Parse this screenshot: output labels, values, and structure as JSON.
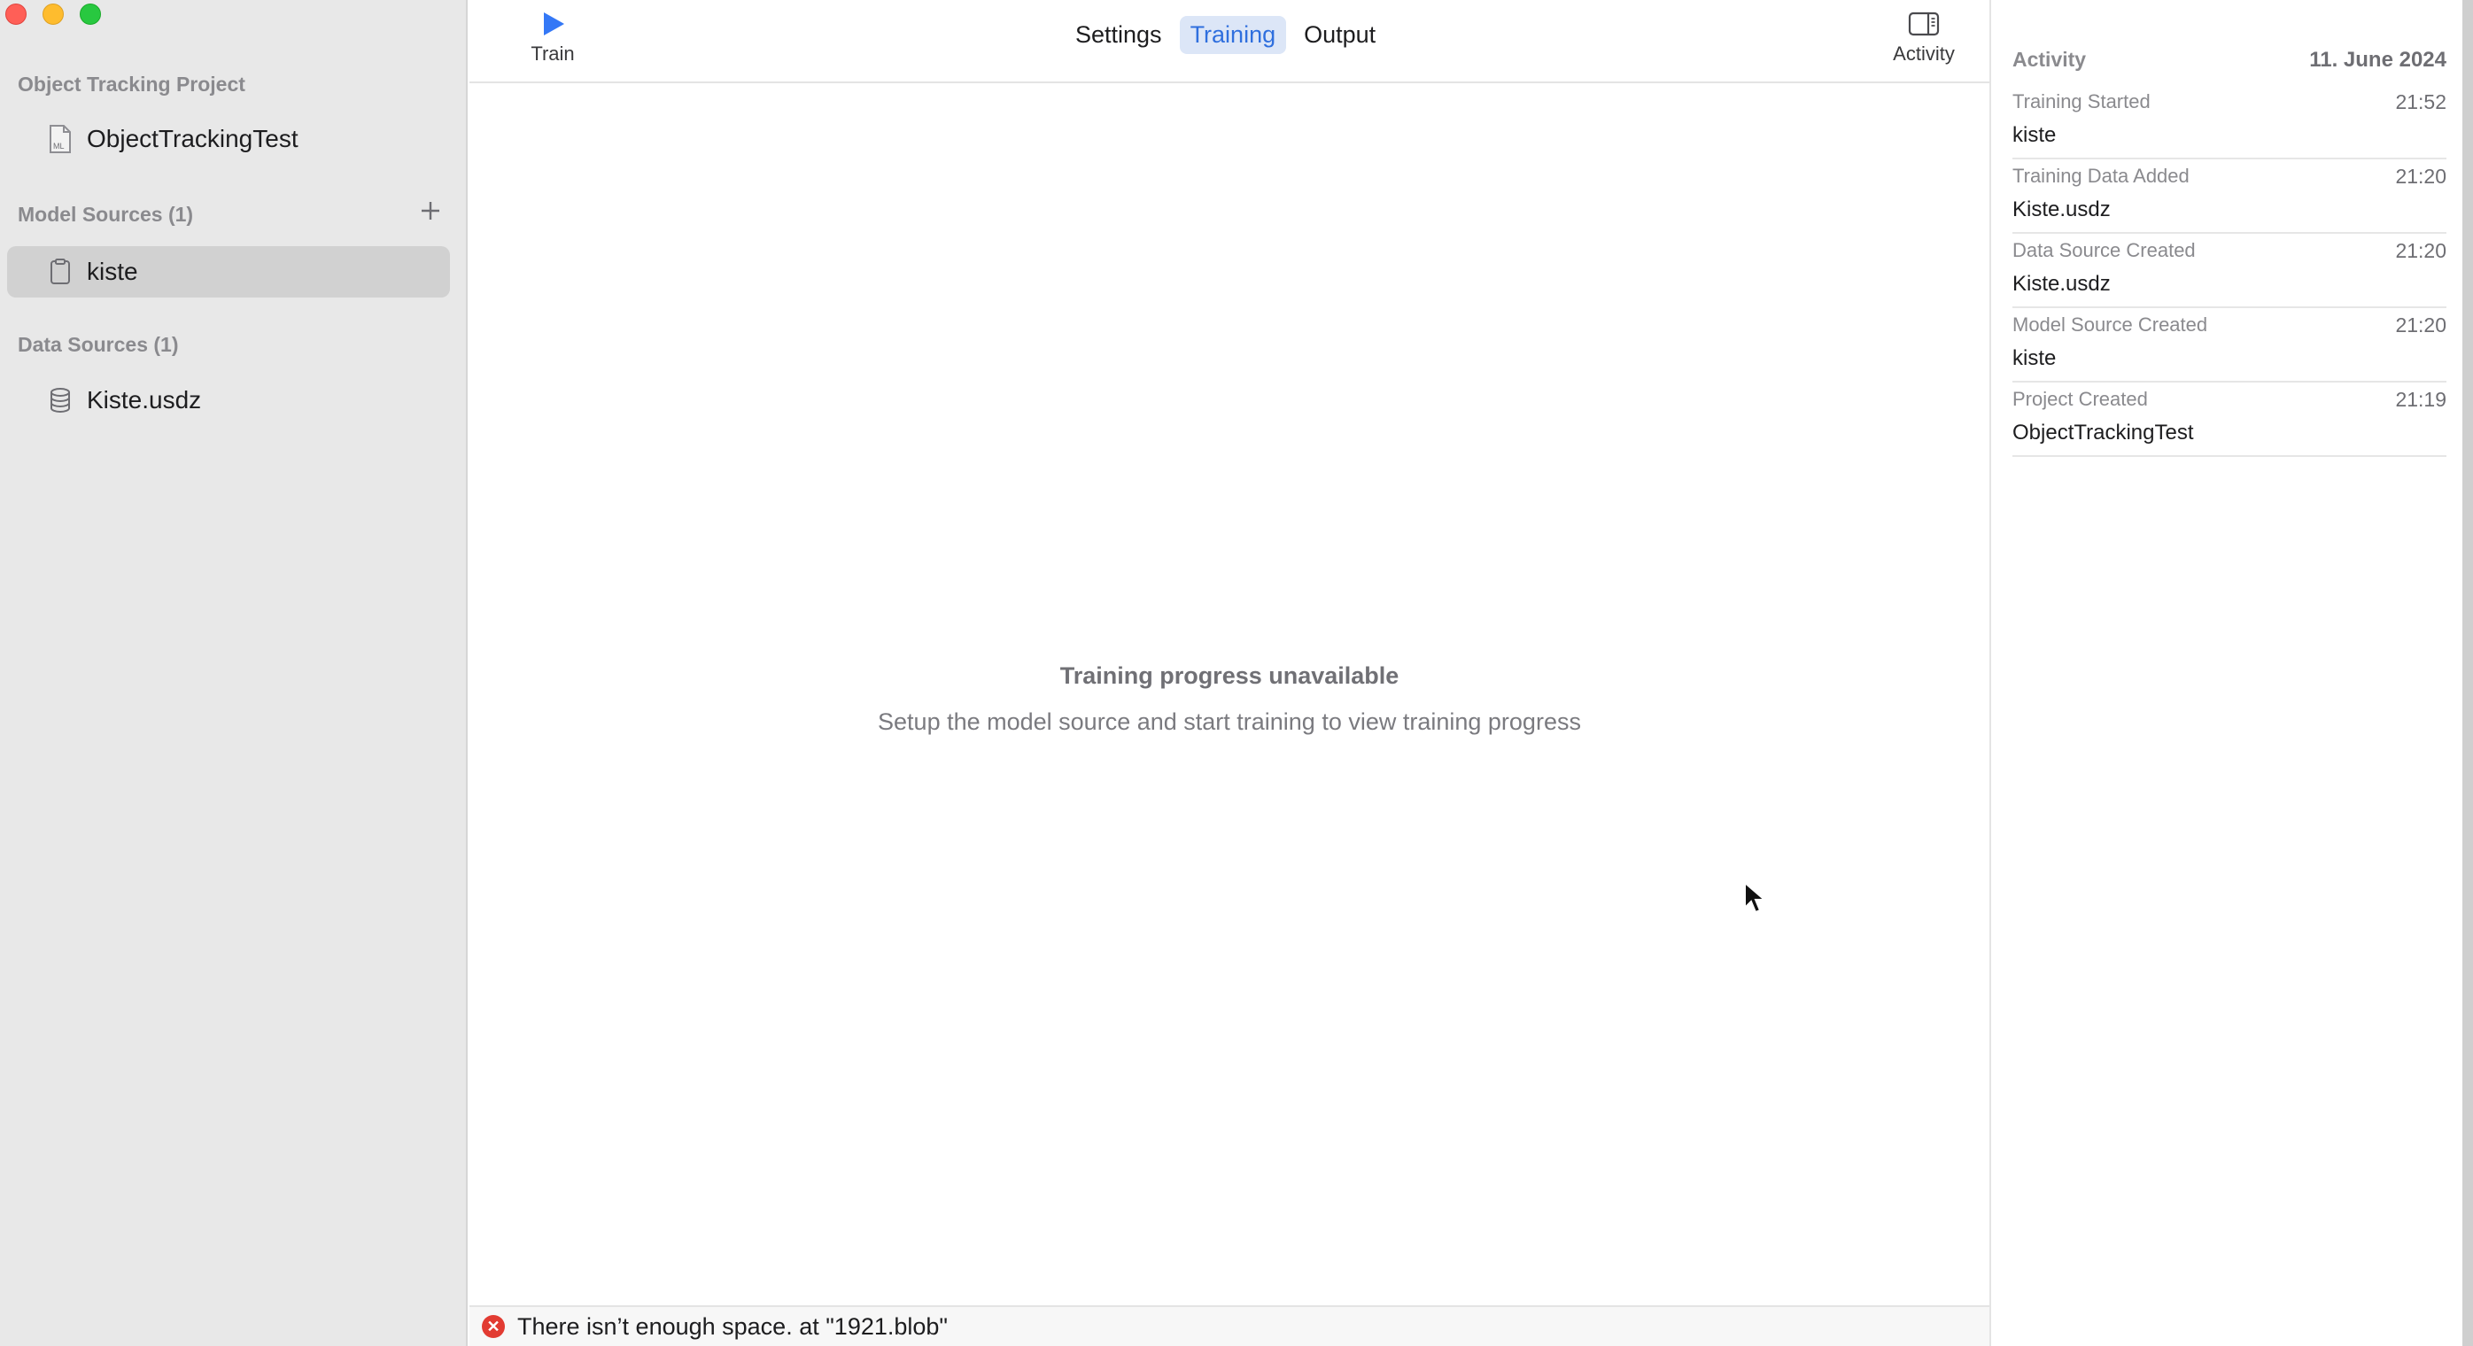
{
  "sidebar": {
    "project_header": "Object Tracking Project",
    "project_item": {
      "label": "ObjectTrackingTest",
      "icon": "ml-file-icon"
    },
    "model_sources_header": "Model Sources (1)",
    "model_sources": [
      {
        "label": "kiste",
        "icon": "document-icon",
        "selected": true
      }
    ],
    "data_sources_header": "Data Sources (1)",
    "data_sources": [
      {
        "label": "Kiste.usdz",
        "icon": "database-icon"
      }
    ]
  },
  "toolbar": {
    "train_label": "Train",
    "tabs": [
      {
        "label": "Settings",
        "active": false
      },
      {
        "label": "Training",
        "active": true
      },
      {
        "label": "Output",
        "active": false
      }
    ],
    "activity_label": "Activity"
  },
  "main": {
    "empty_title": "Training progress unavailable",
    "empty_subtitle": "Setup the model source and start training to view training progress"
  },
  "error": {
    "message": "There isn’t enough space. at \"1921.blob\""
  },
  "activity": {
    "title": "Activity",
    "date": "11. June 2024",
    "items": [
      {
        "event": "Training Started",
        "time": "21:52",
        "subject": "kiste"
      },
      {
        "event": "Training Data Added",
        "time": "21:20",
        "subject": "Kiste.usdz"
      },
      {
        "event": "Data Source Created",
        "time": "21:20",
        "subject": "Kiste.usdz"
      },
      {
        "event": "Model Source Created",
        "time": "21:20",
        "subject": "kiste"
      },
      {
        "event": "Project Created",
        "time": "21:19",
        "subject": "ObjectTrackingTest"
      }
    ]
  },
  "colors": {
    "accent": "#2f6fde",
    "tab_active_bg": "#dce6f7",
    "error": "#e23b32",
    "play": "#3478f6"
  }
}
